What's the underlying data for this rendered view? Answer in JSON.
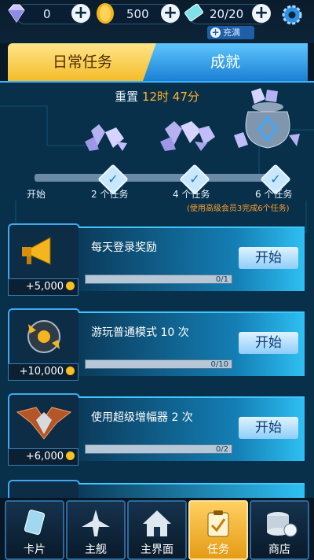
{
  "resources": {
    "gems": "0",
    "coins": "500",
    "energy": "20/20",
    "recharge_label": "充满"
  },
  "tabs": {
    "daily": "日常任务",
    "achievements": "成就"
  },
  "reset": {
    "label": "重置",
    "time": "12时 47分"
  },
  "milestones": {
    "start": "开始",
    "m1": "2 个任务",
    "m2": "4 个任务",
    "m3": "6 个任务",
    "note": "(使用高级会员3完成6个任务)"
  },
  "quests": [
    {
      "title": "每天登录奖励",
      "reward": "+5,000",
      "progress": "0/1",
      "progress_value": 0,
      "button": "开始",
      "icon": "megaphone-icon"
    },
    {
      "title": "游玩普通模式 10 次",
      "reward": "+10,000",
      "progress": "0/10",
      "progress_value": 0,
      "button": "开始",
      "icon": "ship-orb-icon"
    },
    {
      "title": "使用超级增幅器 2 次",
      "reward": "+6,000",
      "progress": "0/2",
      "progress_value": 0,
      "button": "开始",
      "icon": "rank-badge-icon"
    }
  ],
  "nav": {
    "cards": "卡片",
    "ship": "主舰",
    "home": "主界面",
    "tasks": "任务",
    "shop": "商店"
  },
  "colors": {
    "accent_gold": "#f4bc2a",
    "accent_blue": "#1a7fd3",
    "timer_orange": "#ffb22e"
  }
}
